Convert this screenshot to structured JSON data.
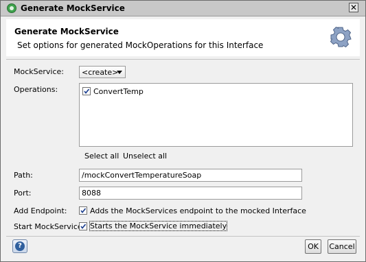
{
  "window": {
    "title": "Generate MockService",
    "close_glyph": "✕"
  },
  "header": {
    "title": "Generate MockService",
    "description": "Set options for generated MockOperations for this Interface",
    "icon": "gear-icon"
  },
  "form": {
    "mockservice_label": "MockService:",
    "mockservice_value": "<create>",
    "operations_label": "Operations:",
    "operations": [
      {
        "label": "ConvertTemp",
        "checked": true
      }
    ],
    "select_all": "Select all",
    "unselect_all": "Unselect all",
    "path_label": "Path:",
    "path_value": "/mockConvertTemperatureSoap",
    "port_label": "Port:",
    "port_value": "8088",
    "add_endpoint_label": "Add Endpoint:",
    "add_endpoint_text": "Adds the MockServices endpoint to the mocked Interface",
    "add_endpoint_checked": true,
    "start_label": "Start MockService:",
    "start_text": "Starts the MockService immediately",
    "start_checked": true
  },
  "buttons": {
    "help": "?",
    "ok": "OK",
    "cancel": "Cancel"
  }
}
